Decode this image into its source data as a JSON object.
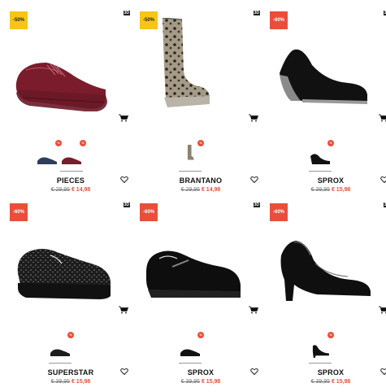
{
  "products": [
    {
      "badge": "-50%",
      "badge_color": "#f5c518",
      "tag": "3D",
      "brand": "PIECES",
      "old_price": "€ 29,95",
      "new_price": "€ 14,98",
      "variants": [
        "navy sneaker",
        "burgundy sneaker"
      ]
    },
    {
      "badge": "-50%",
      "badge_color": "#f5c518",
      "tag": "3D",
      "brand": "BRANTANO",
      "old_price": "€ 29,95",
      "new_price": "€ 14,98",
      "variants": [
        "leopard rain boot"
      ]
    },
    {
      "badge": "-60%",
      "badge_color": "#e94e3c",
      "tag": "3D",
      "brand": "SPROX",
      "old_price": "€ 39,95",
      "new_price": "€ 15,98",
      "variants": [
        "black wedge pump"
      ]
    },
    {
      "badge": "-60%",
      "badge_color": "#e94e3c",
      "tag": "3D",
      "brand": "SUPERSTAR",
      "old_price": "€ 39,95",
      "new_price": "€ 15,98",
      "variants": [
        "black sequin sneaker"
      ]
    },
    {
      "badge": "-60%",
      "badge_color": "#e94e3c",
      "tag": "3D",
      "brand": "SPROX",
      "old_price": "€ 39,95",
      "new_price": "€ 15,98",
      "variants": [
        "black patent slip-on"
      ]
    },
    {
      "badge": "-60%",
      "badge_color": "#e94e3c",
      "tag": "3D",
      "brand": "SPROX",
      "old_price": "€ 39,95",
      "new_price": "€ 15,98",
      "variants": [
        "black patent pump"
      ]
    }
  ],
  "colors": {
    "sale_red": "#e94e3c",
    "sale_yellow": "#f5c518"
  }
}
